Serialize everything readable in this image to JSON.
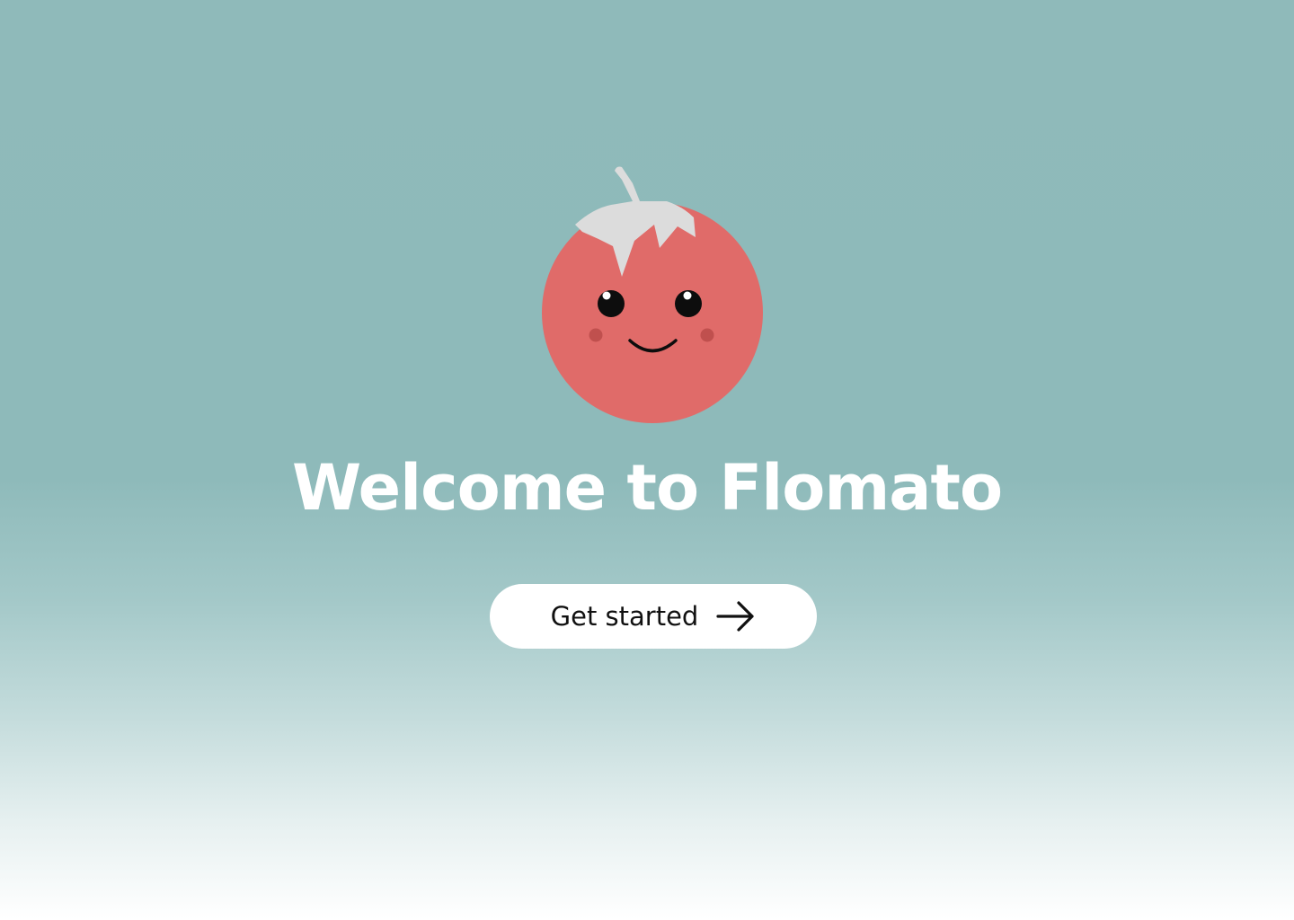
{
  "mascot": {
    "icon": "tomato-mascot-icon",
    "body_color": "#e06b69",
    "leaf_color": "#dcdcdc",
    "eye_color": "#0d0d0d",
    "cheek_color": "#c0504e"
  },
  "welcome": {
    "title": "Welcome to Flomato"
  },
  "cta": {
    "label": "Get started",
    "icon": "arrow-right-icon"
  },
  "theme": {
    "background_top": "#8fbaba",
    "background_bottom": "#ffffff",
    "title_color": "#ffffff",
    "button_color": "#ffffff"
  }
}
